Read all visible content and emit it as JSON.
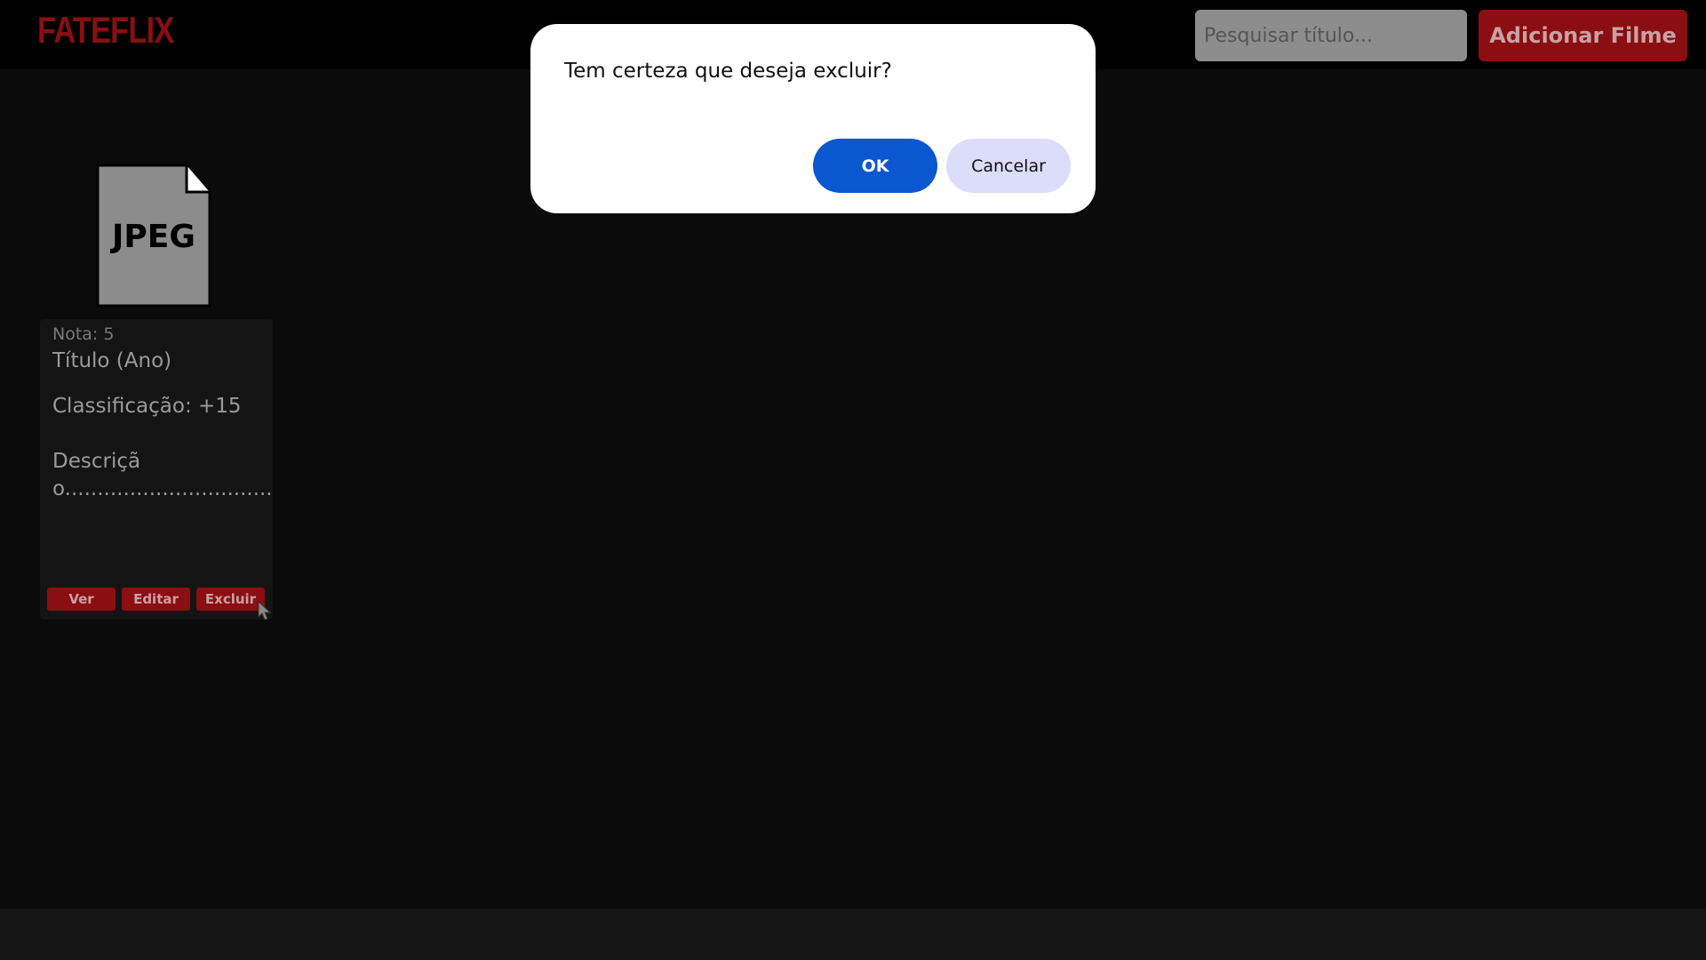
{
  "header": {
    "logo": "FATEFLIX",
    "search_placeholder": "Pesquisar título...",
    "add_button_label": "Adicionar Filme"
  },
  "movies": [
    {
      "poster_label": "JPEG",
      "nota": "Nota: 5",
      "titulo": "Título (Ano)",
      "classificacao": "Classificação: +15",
      "descricao": "Descrição.........................................................................................................................................",
      "buttons": {
        "ver": "Ver",
        "editar": "Editar",
        "excluir": "Excluir"
      }
    }
  ],
  "dialog": {
    "message": "Tem certeza que deseja excluir?",
    "ok_label": "OK",
    "cancel_label": "Cancelar"
  },
  "colors": {
    "brand": "#8a0e12",
    "background": "#0b0b0b",
    "dialog_ok": "#0b57d0",
    "dialog_cancel": "#dcdcfb"
  },
  "icons": {
    "poster": "jpeg-file-icon",
    "cursor": "mouse-pointer-icon"
  }
}
